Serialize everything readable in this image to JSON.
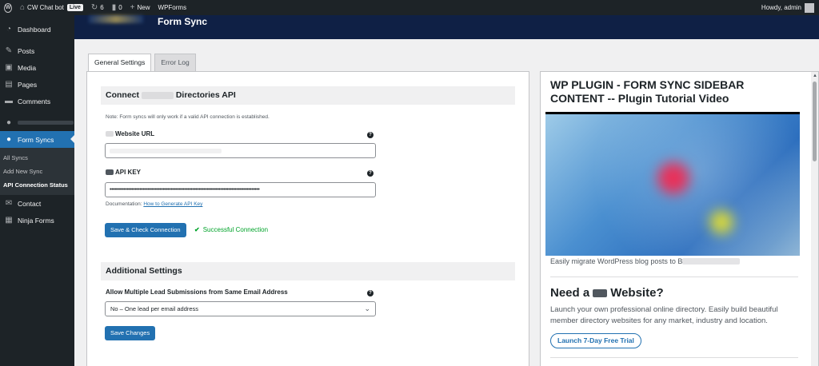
{
  "adminbar": {
    "site_name": "CW Chat bot",
    "live_badge": "Live",
    "updates_count": "6",
    "comments_count": "0",
    "new_label": "New",
    "wpforms_label": "WPForms",
    "howdy": "Howdy, admin"
  },
  "sidebar": {
    "items": [
      {
        "label": "Dashboard",
        "icon": "dashboard-icon"
      },
      {
        "label": "Posts",
        "icon": "pin-icon"
      },
      {
        "label": "Media",
        "icon": "media-icon"
      },
      {
        "label": "Pages",
        "icon": "pages-icon"
      },
      {
        "label": "Comments",
        "icon": "comment-icon"
      }
    ],
    "form_syncs_label": "Form Syncs",
    "submenu": [
      "All Syncs",
      "Add New Sync",
      "API Connection Status"
    ],
    "after": [
      {
        "label": "Contact",
        "icon": "mail-icon"
      },
      {
        "label": "Ninja Forms",
        "icon": "forms-icon"
      }
    ]
  },
  "header": {
    "title": "Form Sync"
  },
  "tabs": [
    "General Settings",
    "Error Log"
  ],
  "connect": {
    "heading_prefix": "Connect",
    "heading_suffix": "Directories API",
    "note": "Note: Form syncs will only work if a valid API connection is established.",
    "website_url_label": "Website URL",
    "api_key_label": "API KEY",
    "api_key_value": "••••••••••••••••••••••••••••••••••••••••••••••••••••••••••••••••••••••••••••••••••••••••••••••••",
    "doc_prefix": "Documentation:",
    "doc_link": "How to Generate API Key",
    "save_check_button": "Save & Check Connection",
    "status": "Successful Connection"
  },
  "additional": {
    "heading": "Additional Settings",
    "lead_label": "Allow Multiple Lead Submissions from Same Email Address",
    "lead_value": "No – One lead per email address",
    "save_button": "Save Changes"
  },
  "right_panel": {
    "title": "WP PLUGIN - FORM SYNC SIDEBAR CONTENT -- Plugin Tutorial Video",
    "caption": "Easily migrate WordPress blog posts to B",
    "need_prefix": "Need a",
    "need_suffix": "Website?",
    "description": "Launch your own professional online directory. Easily build beautiful member directory websites for any market, industry and location.",
    "trial_button": "Launch 7-Day Free Trial"
  },
  "colors": {
    "accent": "#2271b1",
    "admin_dark": "#1d2327",
    "header_navy": "#0f2045",
    "success": "#00a32a"
  }
}
